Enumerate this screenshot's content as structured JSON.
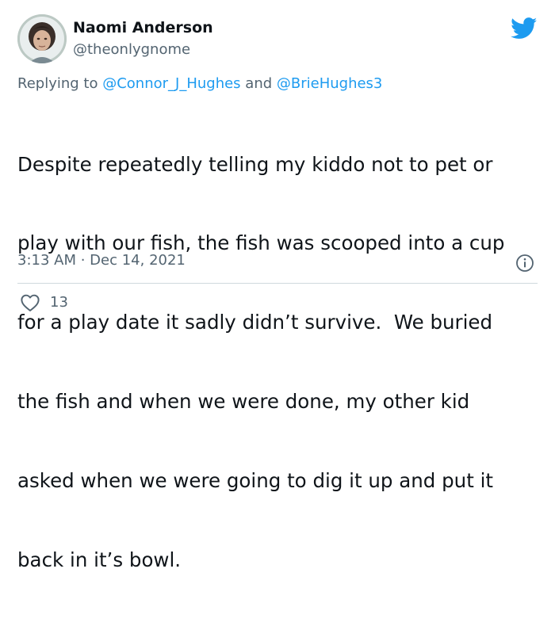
{
  "tweet": {
    "author_name": "Naomi Anderson",
    "author_handle": "@theonlygnome",
    "replying_prefix": "Replying to ",
    "replying_mentions": [
      "@Connor_J_Hughes",
      "@BrieHughes3"
    ],
    "replying_joiner": " and ",
    "body_lines": [
      "Despite repeatedly telling my kiddo not to pet or",
      "play with our fish, the fish was scooped into a cup",
      "for a play date it sadly didn’t survive.  We buried",
      "the fish and when we were done, my other kid",
      "asked when we were going to dig it up and put it",
      "back in it’s bowl."
    ],
    "time": "3:13 AM",
    "separator": " · ",
    "date": "Dec 14, 2021",
    "like_count": "13"
  },
  "icons": {
    "brand": "twitter-bird-icon",
    "info": "info-icon",
    "like": "heart-icon"
  },
  "colors": {
    "brand_blue": "#1d9bf0",
    "secondary_text": "#536471",
    "primary_text": "#0f1419",
    "divider": "#cfd9de"
  }
}
